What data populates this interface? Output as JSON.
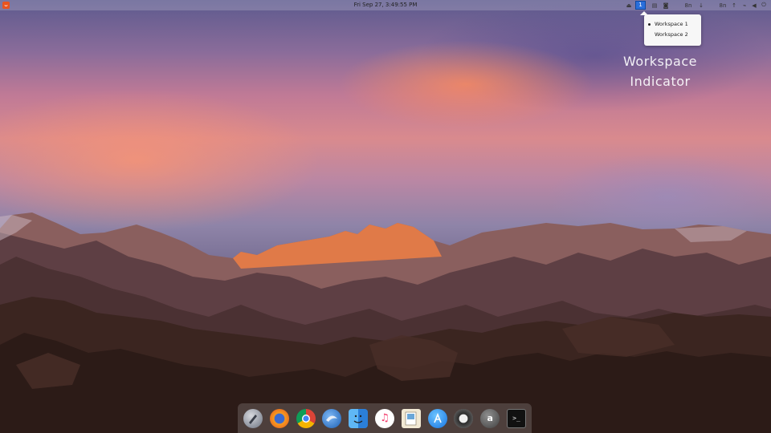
{
  "top_panel": {
    "activities_icon": "ubuntu-logo-icon",
    "clock": "Fri Sep 27,  3:49:55 PM",
    "tray_left": [
      "eject-icon",
      "workspace-indicator-icon",
      "screen-icon",
      "camera-icon"
    ],
    "workspace_number": "1",
    "tray_right": [
      "cpu-monitor-icon",
      "download-icon",
      "mem-monitor-icon",
      "upload-icon",
      "network-icon",
      "volume-icon",
      "power-icon"
    ],
    "cpu_label": "8n",
    "mem_label": "8n"
  },
  "workspace_menu": {
    "items": [
      "Workspace 1",
      "Workspace 2"
    ],
    "active_index": 0
  },
  "caption": {
    "line1": "Workspace",
    "line2": "Indicator"
  },
  "dock": {
    "apps": [
      "launchpad-icon",
      "firefox-icon",
      "chrome-icon",
      "thunderbird-icon",
      "finder-icon",
      "music-icon",
      "preview-icon",
      "app-store-icon",
      "settings-icon",
      "amazon-icon",
      "terminal-icon"
    ]
  }
}
